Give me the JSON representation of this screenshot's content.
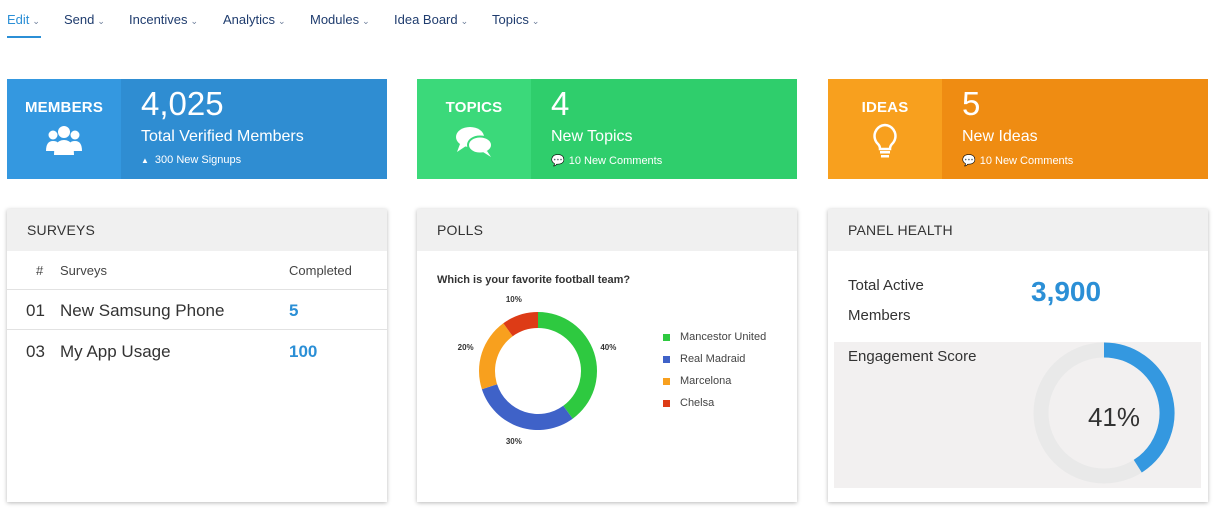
{
  "nav": {
    "items": [
      {
        "label": "Edit",
        "active": true
      },
      {
        "label": "Send",
        "active": false
      },
      {
        "label": "Incentives",
        "active": false
      },
      {
        "label": "Analytics",
        "active": false
      },
      {
        "label": "Modules",
        "active": false
      },
      {
        "label": "Idea Board",
        "active": false
      },
      {
        "label": "Topics",
        "active": false
      }
    ],
    "chevron": "⌄"
  },
  "stats": {
    "members": {
      "label": "MEMBERS",
      "value": "4,025",
      "caption": "Total Verified Members",
      "sub": "300 New Signups",
      "sub_icon": "up-triangle-icon",
      "icon": "users-icon"
    },
    "topics": {
      "label": "TOPICS",
      "value": "4",
      "caption": "New Topics",
      "sub": "10 New Comments",
      "sub_icon": "comment-icon",
      "icon": "chat-bubbles-icon"
    },
    "ideas": {
      "label": "IDEAS",
      "value": "5",
      "caption": "New Ideas",
      "sub": "10 New Comments",
      "sub_icon": "comment-icon",
      "icon": "lightbulb-icon"
    }
  },
  "colors": {
    "blue": "#2f8dd2",
    "green": "#2fce6c",
    "orange": "#ef8c12",
    "accent": "#2b8fd6"
  },
  "surveys": {
    "title": "SURVEYS",
    "headers": {
      "num": "#",
      "name": "Surveys",
      "completed": "Completed"
    },
    "rows": [
      {
        "num": "01",
        "name": "New Samsung Phone",
        "completed": "5"
      },
      {
        "num": "03",
        "name": "My App Usage",
        "completed": "100"
      }
    ]
  },
  "polls": {
    "title": "POLLS",
    "question": "Which is your favorite football team?"
  },
  "chart_data": {
    "type": "pie",
    "donut": true,
    "categories": [
      "Mancestor United",
      "Real Madraid",
      "Marcelona",
      "Chelsa"
    ],
    "values": [
      40,
      30,
      20,
      10
    ],
    "labels": [
      "40%",
      "30%",
      "20%",
      "10%"
    ],
    "colors": [
      "#2ec940",
      "#3f62c8",
      "#f8a01e",
      "#dd3b16"
    ],
    "legend": "right"
  },
  "panel_health": {
    "title": "PANEL HEALTH",
    "active_label_line1": "Total Active",
    "active_label_line2": "Members",
    "active_value": "3,900",
    "engagement_label": "Engagement Score",
    "engagement_value": 41,
    "engagement_text": "41%",
    "gauge_color": "#3498e0",
    "gauge_track": "#e9e9e9"
  }
}
